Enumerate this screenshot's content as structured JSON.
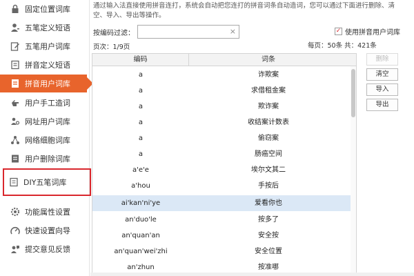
{
  "sidebar": {
    "items": [
      {
        "label": "固定位置词库",
        "icon": "lock-icon"
      },
      {
        "label": "五笔定义短语",
        "icon": "user-icon"
      },
      {
        "label": "五笔用户词库",
        "icon": "edit-icon"
      },
      {
        "label": "拼音定义短语",
        "icon": "book-icon"
      },
      {
        "label": "拼音用户词库",
        "icon": "document-icon",
        "active": true
      },
      {
        "label": "用户手工造词",
        "icon": "hand-icon"
      },
      {
        "label": "网址用户词库",
        "icon": "users-icon"
      },
      {
        "label": "网络细胞词库",
        "icon": "network-icon"
      },
      {
        "label": "用户删除词库",
        "icon": "delete-doc-icon"
      },
      {
        "label": "DIY五笔词库",
        "icon": "diy-doc-icon",
        "highlighted": true
      },
      {
        "label": "功能属性设置",
        "icon": "gear-icon"
      },
      {
        "label": "快速设置向导",
        "icon": "wizard-icon"
      },
      {
        "label": "提交意见反馈",
        "icon": "feedback-icon"
      }
    ]
  },
  "main": {
    "description": "通过输入法直接使用拼音连打，系统会自动把您连打的拼音词条自动造词，您可以通过下面进行删除、清空、导入、导出等操作。",
    "filter": {
      "label": "按编码过滤：",
      "value": "",
      "placeholder": "",
      "clear_symbol": "×"
    },
    "use_pinyin_lib": {
      "label": "使用拼音用户词库",
      "checked": true
    },
    "page_info": "页次：1/9页",
    "per_page_info": "每页：50条 共：421条",
    "table": {
      "columns": [
        "编码",
        "词条"
      ],
      "rows": [
        {
          "code": "a",
          "word": "诈欺案"
        },
        {
          "code": "a",
          "word": "求借租金案"
        },
        {
          "code": "a",
          "word": "欺诈案"
        },
        {
          "code": "a",
          "word": "收结案计数表"
        },
        {
          "code": "a",
          "word": "偷窃案"
        },
        {
          "code": "a",
          "word": "肠癌空间"
        },
        {
          "code": "a'e'e",
          "word": "埃尔文其二"
        },
        {
          "code": "a'hou",
          "word": "手按后"
        },
        {
          "code": "ai'kan'ni'ye",
          "word": "爱看你也",
          "selected": true
        },
        {
          "code": "an'duo'le",
          "word": "按多了"
        },
        {
          "code": "an'quan'an",
          "word": "安全按"
        },
        {
          "code": "an'quan'wei'zhi",
          "word": "安全位置"
        },
        {
          "code": "an'zhun",
          "word": "按准哪"
        }
      ]
    },
    "buttons": {
      "delete": "删除",
      "clear": "清空",
      "import": "导入",
      "export": "导出"
    }
  },
  "colors": {
    "accent": "#e8642c",
    "highlight_box": "#d9262c",
    "selected_row": "#dbe8f6"
  }
}
